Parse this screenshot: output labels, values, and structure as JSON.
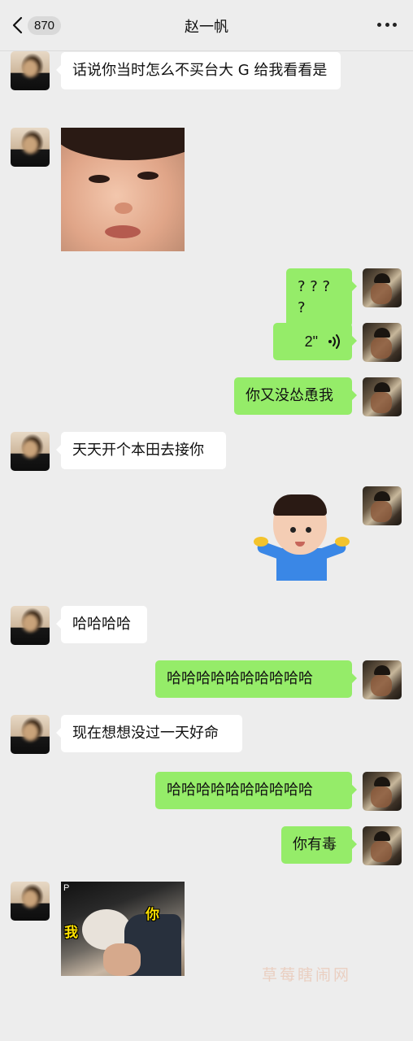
{
  "header": {
    "back_count": "870",
    "title": "赵一帆"
  },
  "messages": [
    {
      "side": "in",
      "type": "text",
      "text": "话说你当时怎么不买台大 G 给我看看是"
    },
    {
      "side": "in",
      "type": "sticker",
      "sticker": "baby-face-closeup"
    },
    {
      "side": "out",
      "type": "text",
      "text": "? ? ? ?"
    },
    {
      "side": "out",
      "type": "voice",
      "duration": "2\""
    },
    {
      "side": "out",
      "type": "text",
      "text": "你又没怂恿我"
    },
    {
      "side": "in",
      "type": "text",
      "text": "天天开个本田去接你"
    },
    {
      "side": "out",
      "type": "sticker",
      "sticker": "baby-shrug"
    },
    {
      "side": "in",
      "type": "text",
      "text": "哈哈哈哈"
    },
    {
      "side": "out",
      "type": "text",
      "text": "哈哈哈哈哈哈哈哈哈哈"
    },
    {
      "side": "in",
      "type": "text",
      "text": "现在想想没过一天好命"
    },
    {
      "side": "out",
      "type": "text",
      "text": "哈哈哈哈哈哈哈哈哈哈"
    },
    {
      "side": "out",
      "type": "text",
      "text": "你有毒"
    },
    {
      "side": "in",
      "type": "sticker",
      "sticker": "gif-meme",
      "caption_right": "你",
      "caption_left": "我",
      "corner_mark": "P"
    }
  ],
  "watermark": "草莓瞎闹网",
  "colors": {
    "background": "#ededed",
    "incoming_bubble": "#ffffff",
    "outgoing_bubble": "#95ec69"
  }
}
